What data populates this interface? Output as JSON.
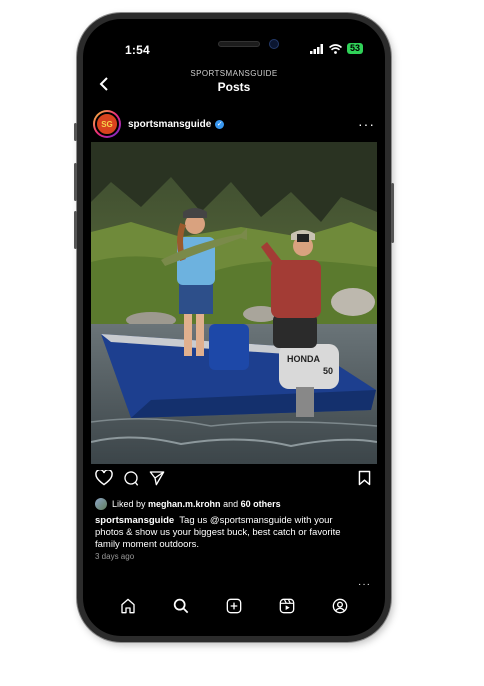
{
  "status": {
    "time": "1:54",
    "battery": "53"
  },
  "nav": {
    "subtitle": "SPORTSMANSGUIDE",
    "title": "Posts"
  },
  "post": {
    "avatar_text": "SG",
    "username": "sportsmansguide",
    "likes": {
      "prefix": "Liked by",
      "user": "meghan.m.krohn",
      "mid": "and",
      "count": "60 others"
    },
    "caption": {
      "username": "sportsmansguide",
      "text": "Tag us @sportsmansguide with your photos & show us your biggest buck, best catch or favorite family moment outdoors."
    },
    "time_ago": "3 days ago",
    "image_labels": {
      "boat_brand": "HONDA",
      "engine_hp": "50"
    }
  },
  "icons": [
    "back-icon",
    "more-icon",
    "heart-icon",
    "comment-icon",
    "share-icon",
    "bookmark-icon",
    "home-icon",
    "search-icon",
    "create-icon",
    "reels-icon",
    "profile-icon"
  ],
  "colors": {
    "background": "#000000",
    "verified": "#3897f0",
    "battery": "#30d158"
  }
}
